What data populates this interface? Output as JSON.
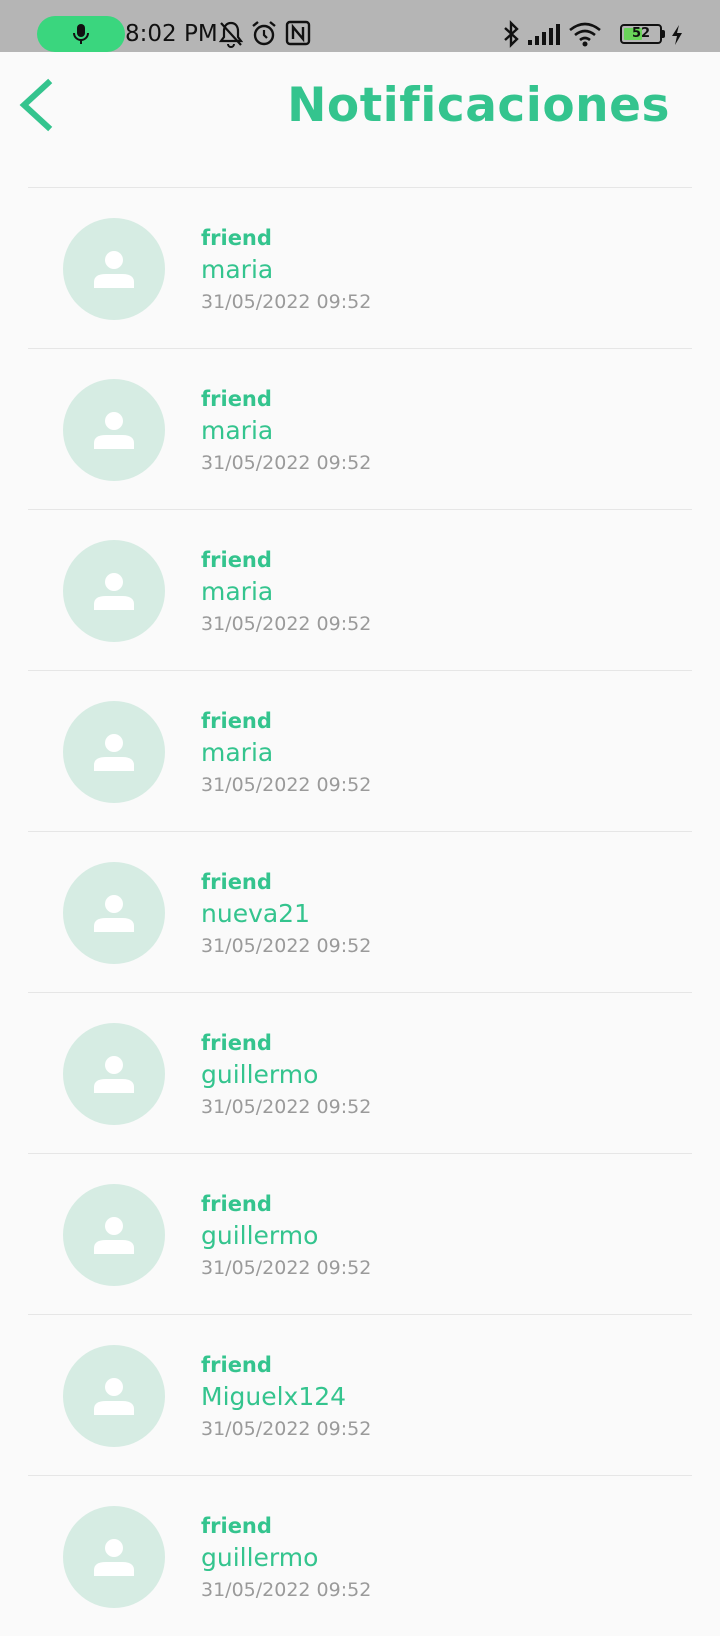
{
  "status_bar": {
    "time": "8:02 PM",
    "battery_level": "52",
    "battery_fraction": 0.52,
    "icons": [
      "mic-icon",
      "notifications-off-icon",
      "alarm-icon",
      "nfc-icon",
      "bluetooth-icon",
      "signal-icon",
      "wifi-icon",
      "battery-icon",
      "charging-icon"
    ]
  },
  "header": {
    "title": "Notificaciones",
    "back_icon": "chevron-left-icon"
  },
  "colors": {
    "accent": "#34c48e",
    "avatar_bg": "#d6ece3",
    "timestamp": "#9a9a9a",
    "mic_pill": "#3ad67e"
  },
  "notifications": [
    {
      "type": "friend",
      "name": "maria",
      "time": "31/05/2022 09:52"
    },
    {
      "type": "friend",
      "name": "maria",
      "time": "31/05/2022 09:52"
    },
    {
      "type": "friend",
      "name": "maria",
      "time": "31/05/2022 09:52"
    },
    {
      "type": "friend",
      "name": "maria",
      "time": "31/05/2022 09:52"
    },
    {
      "type": "friend",
      "name": "nueva21",
      "time": "31/05/2022 09:52"
    },
    {
      "type": "friend",
      "name": "guillermo",
      "time": "31/05/2022 09:52"
    },
    {
      "type": "friend",
      "name": "guillermo",
      "time": "31/05/2022 09:52"
    },
    {
      "type": "friend",
      "name": "Miguelx124",
      "time": "31/05/2022 09:52"
    },
    {
      "type": "friend",
      "name": "guillermo",
      "time": "31/05/2022 09:52"
    }
  ]
}
